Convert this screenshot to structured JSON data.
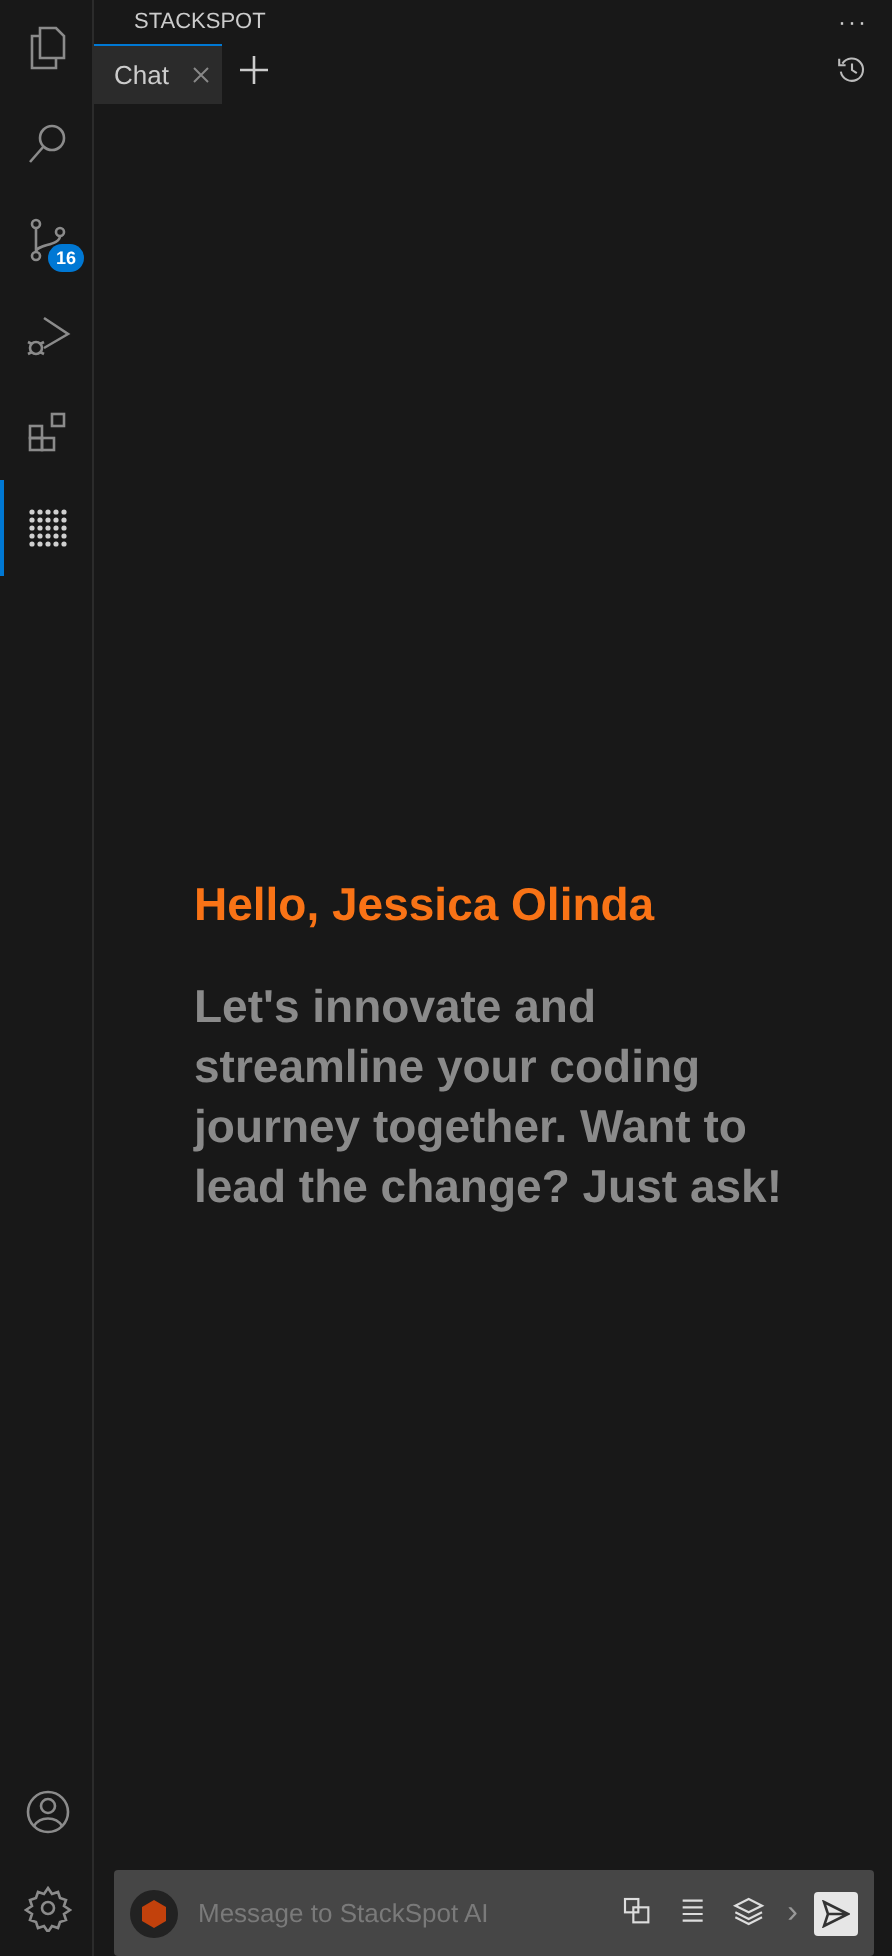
{
  "activity_bar": {
    "items": [
      {
        "kind": "files",
        "selected": false
      },
      {
        "kind": "search",
        "selected": false
      },
      {
        "kind": "source-control",
        "selected": false,
        "badge": "16"
      },
      {
        "kind": "run-debug",
        "selected": false
      },
      {
        "kind": "extensions",
        "selected": false
      },
      {
        "kind": "stackspot",
        "selected": true
      }
    ],
    "bottom": [
      {
        "kind": "account"
      },
      {
        "kind": "settings"
      }
    ]
  },
  "panel": {
    "title": "STACKSPOT",
    "more": "···"
  },
  "tabs": [
    {
      "label": "Chat",
      "selected": true
    }
  ],
  "greeting": "Hello, Jessica Olinda",
  "message": "Let's innovate and streamline your coding journey together. Want to lead the change? Just ask!",
  "composer": {
    "placeholder": "Message to StackSpot AI",
    "more": "›"
  }
}
